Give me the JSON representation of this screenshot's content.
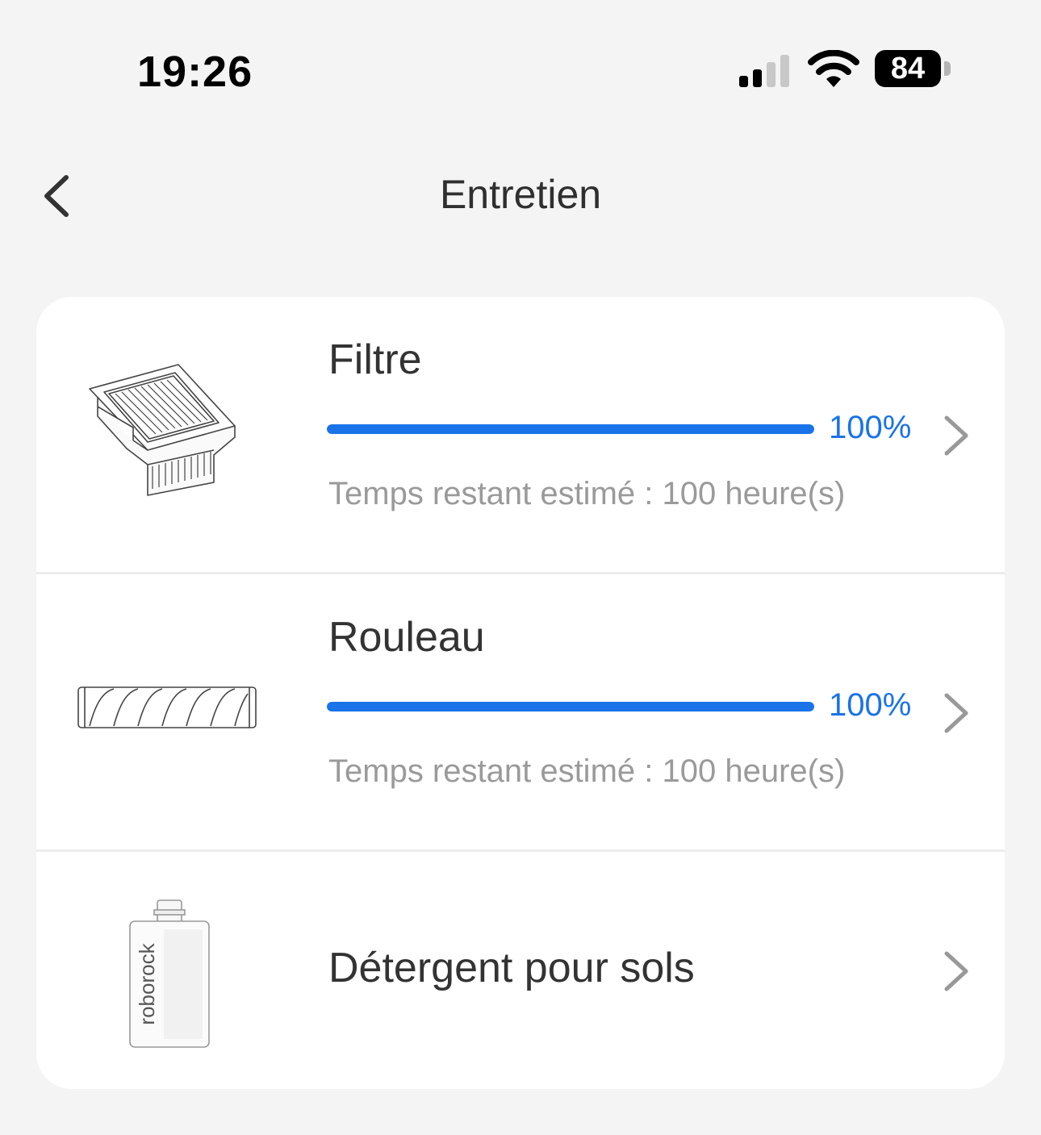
{
  "status_bar": {
    "time": "19:26",
    "signal_icon": "cellular-signal-icon",
    "wifi_icon": "wifi-icon",
    "battery_level": "84"
  },
  "header": {
    "back_icon": "chevron-left-icon",
    "title": "Entretien"
  },
  "colors": {
    "accent": "#1a73e8",
    "background": "#f4f4f4",
    "card": "#ffffff",
    "secondary_text": "#9a9a9a"
  },
  "items": [
    {
      "title": "Filtre",
      "progress": 100,
      "percent_label": "100%",
      "remaining": "Temps restant estimé : 100 heure(s)",
      "image": "filter-image",
      "chevron": "chevron-right-icon"
    },
    {
      "title": "Rouleau",
      "progress": 100,
      "percent_label": "100%",
      "remaining": "Temps restant estimé : 100 heure(s)",
      "image": "roller-image",
      "chevron": "chevron-right-icon"
    },
    {
      "title": "Détergent pour sols",
      "image": "detergent-bottle-image",
      "logo_text": "roborock",
      "chevron": "chevron-right-icon"
    }
  ]
}
